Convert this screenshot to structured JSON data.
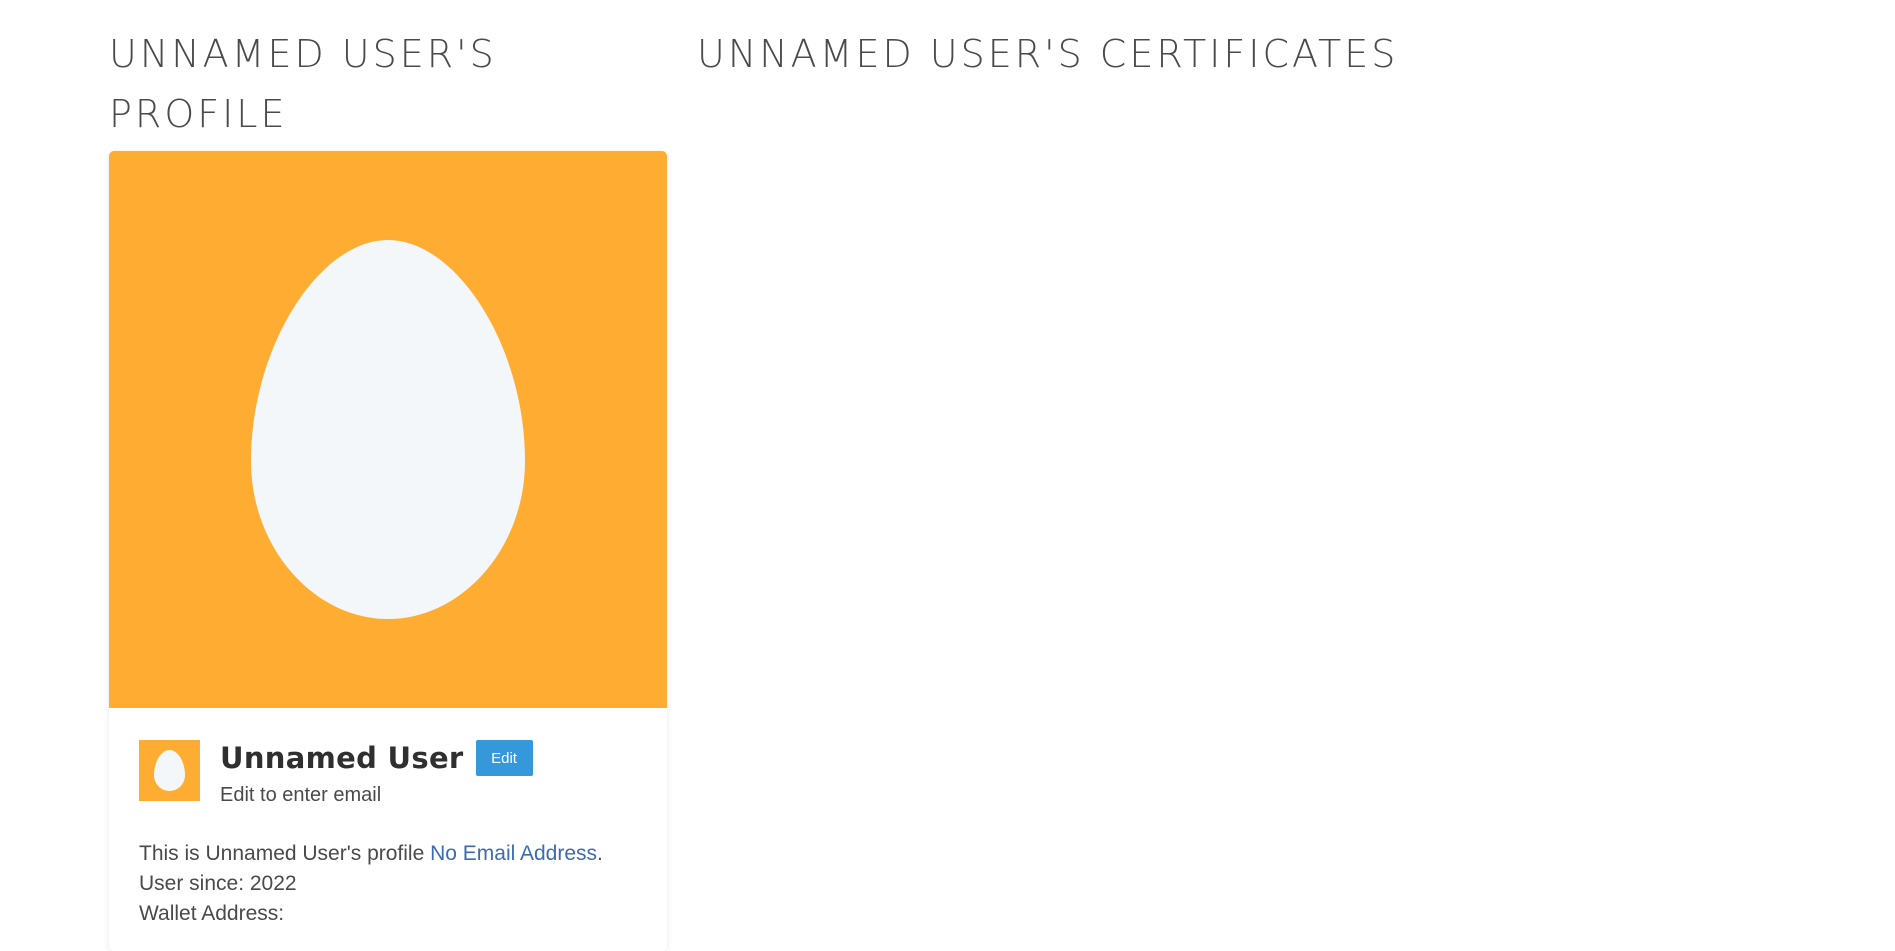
{
  "profile_heading": {
    "line1": "UNNAMED USER'S",
    "line2": "PROFILE"
  },
  "certificates_heading": "UNNAMED USER'S CERTIFICATES",
  "card": {
    "cover_icon": "egg-icon",
    "avatar_icon": "egg-icon",
    "user_name": "Unnamed User",
    "edit_label": "Edit",
    "email_hint": "Edit to enter email",
    "profile_text": "This is Unnamed User's profile",
    "email_link": "No Email Address",
    "period": ".",
    "user_since": "User since: 2022",
    "wallet_label": "Wallet Address:"
  },
  "colors": {
    "accent_orange": "#ffac33",
    "egg_fill": "#f4f7f9",
    "edit_blue": "#3498db",
    "link_blue": "#3d6bb3"
  }
}
